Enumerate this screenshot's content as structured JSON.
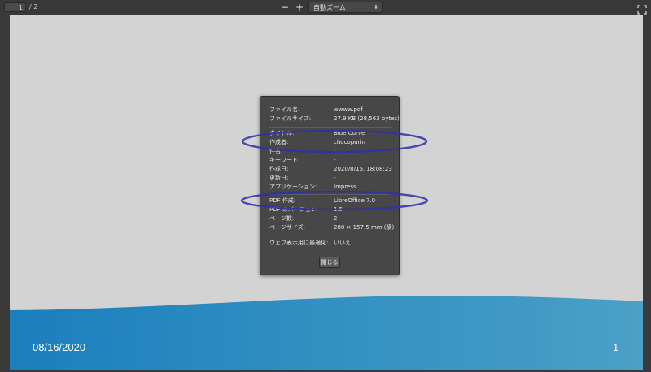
{
  "toolbar": {
    "page_number": "1",
    "page_total": "/ 2",
    "zoom_out_label": "−",
    "zoom_in_label": "+",
    "zoom_value": "自動ズーム"
  },
  "slide": {
    "date": "08/16/2020",
    "number": "1"
  },
  "properties": {
    "rows": [
      {
        "key": "ファイル名:",
        "value": "wwww.pdf"
      },
      {
        "key": "ファイルサイズ:",
        "value": "27.9 KB (28,563 bytes)"
      },
      {
        "key": "タイトル:",
        "value": "Blue Curve"
      },
      {
        "key": "作成者:",
        "value": "chocopurin"
      },
      {
        "key": "件名:",
        "value": "-"
      },
      {
        "key": "キーワード:",
        "value": "-"
      },
      {
        "key": "作成日:",
        "value": "2020/8/16, 18:08:23"
      },
      {
        "key": "更新日:",
        "value": "-"
      },
      {
        "key": "アプリケーション:",
        "value": "Impress"
      },
      {
        "key": "PDF 作成:",
        "value": "LibreOffice 7.0"
      },
      {
        "key": "PDF のバージョン:",
        "value": "1.5"
      },
      {
        "key": "ページ数:",
        "value": "2"
      },
      {
        "key": "ページサイズ:",
        "value": "280 × 157.5 mm (横)"
      },
      {
        "key": "ウェブ表示用に最適化:",
        "value": "いいえ"
      }
    ],
    "close_label": "閉じる"
  },
  "colors": {
    "annotation": "#2f2fa8",
    "wave_dark": "#1b7fbd",
    "wave_light": "#4aa0c6"
  }
}
